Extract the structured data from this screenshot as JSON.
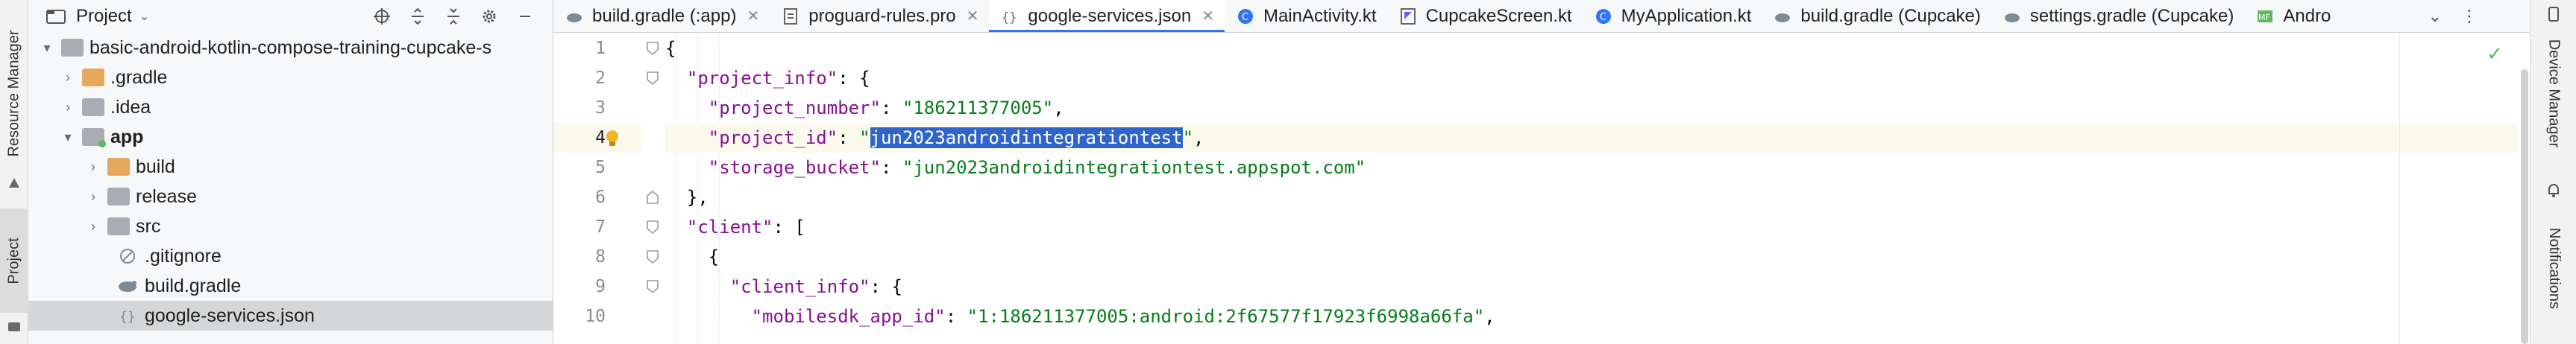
{
  "left_strip": {
    "tabs": [
      "Resource Manager",
      "Project"
    ]
  },
  "project_panel": {
    "title": "Project",
    "tree": [
      {
        "label": "basic-android-kotlin-compose-training-cupcake-s",
        "arrow": "▾",
        "icon": "module-folder-icon"
      },
      {
        "label": ".gradle",
        "arrow": "›",
        "icon": "folder-icon"
      },
      {
        "label": ".idea",
        "arrow": "›",
        "icon": "folder-icon"
      },
      {
        "label": "app",
        "arrow": "▾",
        "icon": "module-folder-icon"
      },
      {
        "label": "build",
        "arrow": "›",
        "icon": "folder-icon"
      },
      {
        "label": "release",
        "arrow": "›",
        "icon": "folder-icon"
      },
      {
        "label": "src",
        "arrow": "›",
        "icon": "folder-icon"
      },
      {
        "label": ".gitignore",
        "arrow": "",
        "icon": "gitignore-file-icon"
      },
      {
        "label": "build.gradle",
        "arrow": "",
        "icon": "gradle-file-icon"
      },
      {
        "label": "google-services.json",
        "arrow": "",
        "icon": "json-file-icon"
      }
    ]
  },
  "tabs": [
    {
      "label": "build.gradle (:app)",
      "icon": "gradle-file-icon",
      "active": false
    },
    {
      "label": "proguard-rules.pro",
      "icon": "text-file-icon",
      "active": false
    },
    {
      "label": "google-services.json",
      "icon": "json-file-icon",
      "active": true
    },
    {
      "label": "MainActivity.kt",
      "icon": "kotlin-class-icon",
      "active": false
    },
    {
      "label": "CupcakeScreen.kt",
      "icon": "kotlin-file-icon",
      "active": false
    },
    {
      "label": "MyApplication.kt",
      "icon": "kotlin-class-icon",
      "active": false
    },
    {
      "label": "build.gradle (Cupcake)",
      "icon": "gradle-file-icon",
      "active": false
    },
    {
      "label": "settings.gradle (Cupcake)",
      "icon": "gradle-file-icon",
      "active": false
    },
    {
      "label": "Andro",
      "icon": "manifest-file-icon",
      "active": false
    }
  ],
  "editor": {
    "line_numbers": [
      "1",
      "2",
      "3",
      "4",
      "5",
      "6",
      "7",
      "8",
      "9",
      "10"
    ],
    "current_line": 4,
    "lines": [
      "{",
      "  \"project_info\": {",
      "    \"project_number\": \"186211377005\",",
      "    \"project_id\": \"jun2023androidintegrationtest\",",
      "    \"storage_bucket\": \"jun2023androidintegrationtest.appspot.com\"",
      "  },",
      "  \"client\": [",
      "    {",
      "      \"client_info\": {",
      "        \"mobilesdk_app_id\": \"1:186211377005:android:2f67577f17923f6998a66fa\","
    ],
    "tokens": {
      "l1_brace": "{",
      "l2_key": "\"project_info\"",
      "l2_rest": ": {",
      "l3_key": "\"project_number\"",
      "l3_colon": ": ",
      "l3_val": "\"186211377005\"",
      "l3_comma": ",",
      "l4_key": "\"project_id\"",
      "l4_colon": ": ",
      "l4_q1": "\"",
      "l4_sel": "jun2023androidintegrationtest",
      "l4_q2": "\"",
      "l4_comma": ",",
      "l5_key": "\"storage_bucket\"",
      "l5_colon": ": ",
      "l5_val": "\"jun2023androidintegrationtest.appspot.com\"",
      "l6": "},",
      "l7_key": "\"client\"",
      "l7_rest": ": [",
      "l8": "{",
      "l9_key": "\"client_info\"",
      "l9_rest": ": {",
      "l10_key": "\"mobilesdk_app_id\"",
      "l10_colon": ": ",
      "l10_val": "\"1:186211377005:android:2f67577f17923f6998a66fa\"",
      "l10_comma": ","
    }
  },
  "right_strip": {
    "tabs": [
      "Device Manager",
      "Notifications"
    ]
  },
  "colors": {
    "accent": "#3574f0",
    "selection": "#2f65ca",
    "json_key": "#871094",
    "json_string": "#067d17",
    "current_line": "#fcfaed"
  }
}
